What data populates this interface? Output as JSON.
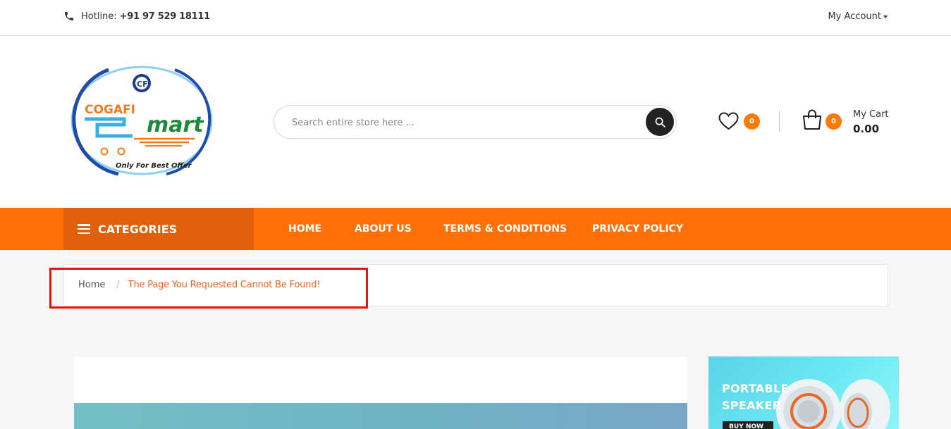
{
  "topbar": {
    "hotline_label": "Hotline:",
    "hotline_number": "+91 97 529 18111",
    "account_label": "My Account"
  },
  "logo": {
    "brand_1": "COGAFI",
    "brand_2": "mart",
    "monogram": "CF",
    "tagline": "Only For Best Offer"
  },
  "search": {
    "placeholder": "Search entire store here ..."
  },
  "wishlist": {
    "count": "0"
  },
  "cart": {
    "count": "0",
    "label": "My Cart",
    "total": "0.00"
  },
  "nav": {
    "categories_label": "CATEGORIES",
    "items": [
      {
        "label": "HOME"
      },
      {
        "label": "ABOUT US"
      },
      {
        "label": "TERMS & CONDITIONS"
      },
      {
        "label": "PRIVACY POLICY"
      }
    ]
  },
  "breadcrumb": {
    "home": "Home",
    "separator": "/",
    "current": "The Page You Requested Cannot Be Found!"
  },
  "side_banner": {
    "title": "PORTABLE SPEAKER",
    "button": "BUY NOW"
  },
  "colors": {
    "accent": "#ff7108",
    "accent_dark": "#e0600b",
    "badge": "#ff7a00",
    "highlight": "#e81010"
  },
  "icons": {
    "phone": "phone-icon",
    "search": "search-icon",
    "wishlist": "heart-icon",
    "cart": "shopping-bag-icon",
    "menu": "hamburger-icon"
  }
}
